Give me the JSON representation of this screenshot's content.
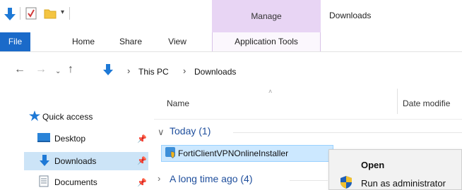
{
  "window": {
    "title": "Downloads",
    "context_tab_group": "Manage"
  },
  "ribbon": {
    "tabs": [
      {
        "label": "File"
      },
      {
        "label": "Home"
      },
      {
        "label": "Share"
      },
      {
        "label": "View"
      },
      {
        "label": "Application Tools"
      }
    ]
  },
  "address_bar": {
    "breadcrumb": [
      "This PC",
      "Downloads"
    ]
  },
  "columns": {
    "name": "Name",
    "date": "Date modifie"
  },
  "nav_pane": {
    "quick_access": "Quick access",
    "items": [
      {
        "label": "Desktop",
        "pinned": true
      },
      {
        "label": "Downloads",
        "pinned": true,
        "selected": true
      },
      {
        "label": "Documents",
        "pinned": true
      }
    ]
  },
  "file_list": {
    "groups": [
      {
        "label": "Today (1)",
        "expanded": true
      },
      {
        "label": "A long time ago (4)",
        "expanded": false
      }
    ],
    "selected_file": "FortiClientVPNOnlineInstaller"
  },
  "context_menu": {
    "items": [
      {
        "label": "Open",
        "default": true
      },
      {
        "label": "Run as administrator"
      }
    ]
  },
  "colors": {
    "file_tab": "#1a6ac9",
    "manage_group": "#e8d5f4",
    "selection": "#cce8ff",
    "nav_selection": "#cce4f7",
    "group_text": "#1e4e9c"
  }
}
